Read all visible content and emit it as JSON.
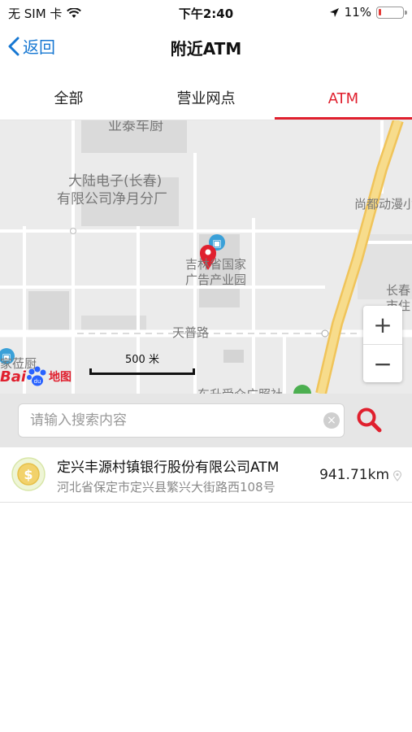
{
  "status_bar": {
    "carrier": "无 SIM 卡",
    "time": "下午2:40",
    "battery_percent": "11%",
    "battery_level": 0.11
  },
  "nav": {
    "back_label": "返回",
    "title": "附近ATM"
  },
  "tabs": [
    {
      "label": "全部",
      "active": false
    },
    {
      "label": "营业网点",
      "active": false
    },
    {
      "label": "ATM",
      "active": true
    }
  ],
  "map": {
    "labels": {
      "top": "业泰车厨",
      "company_line1": "大陆电子(长春)",
      "company_line2": "有限公司净月分厂",
      "shangdu": "尚都动漫小",
      "park_line1": "吉林省国家",
      "park_line2": "广告产业园",
      "changchun_line1": "长春",
      "changchun_line2": "市住",
      "road": "天普路",
      "bottom_left": "家莅厨",
      "bottom_mid": "东升受众广照社"
    },
    "scale_label": "500 米",
    "zoom_in": "+",
    "zoom_out": "−",
    "logo_text": "Bai",
    "logo_map": "地图",
    "colors": {
      "road_main": "#f3d27a",
      "pin": "#e0202e",
      "poi": "#3aa0d8"
    }
  },
  "search": {
    "placeholder": "请输入搜索内容",
    "value": "",
    "clear_icon": "×"
  },
  "results": [
    {
      "name": "定兴丰源村镇银行股份有限公司ATM",
      "address": "河北省保定市定兴县繁兴大街路西108号",
      "distance": "941.71km"
    }
  ]
}
